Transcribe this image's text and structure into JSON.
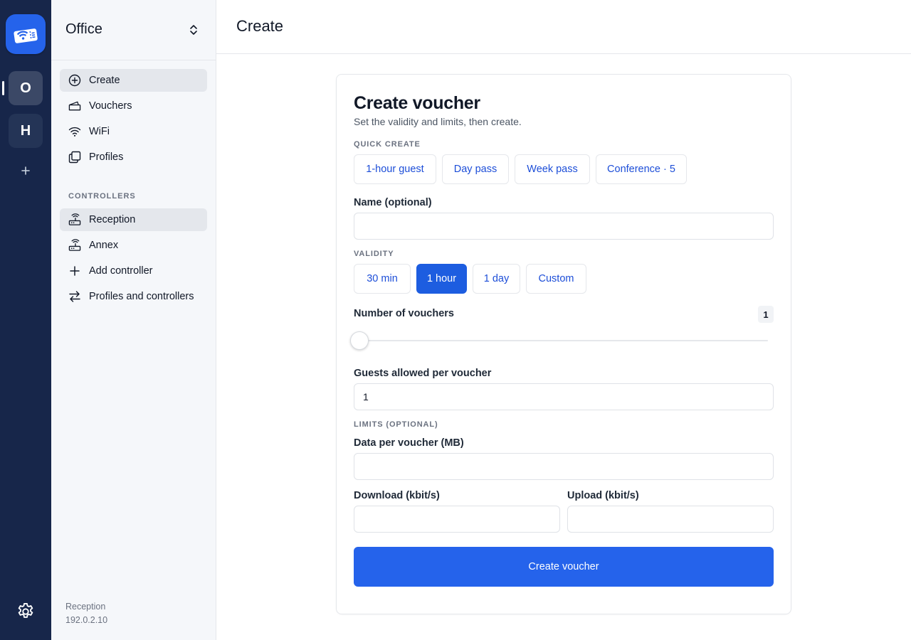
{
  "rail": {
    "profiles": [
      {
        "initial": "O",
        "active": true
      },
      {
        "initial": "H",
        "active": false
      }
    ],
    "icons": {
      "logo": "voucher-wifi-icon",
      "add": "plus-icon",
      "settings": "gear-icon"
    }
  },
  "sidebar": {
    "title": "Office",
    "items": [
      {
        "label": "Create",
        "icon": "plus-circle-icon",
        "active": true
      },
      {
        "label": "Vouchers",
        "icon": "ticket-icon",
        "active": false
      },
      {
        "label": "WiFi",
        "icon": "wifi-icon",
        "active": false
      },
      {
        "label": "Profiles",
        "icon": "stack-icon",
        "active": false
      }
    ],
    "controllers_label": "CONTROLLERS",
    "controllers": [
      {
        "label": "Reception",
        "icon": "router-icon",
        "active": true
      },
      {
        "label": "Annex",
        "icon": "router-icon",
        "active": false
      },
      {
        "label": "Add controller",
        "icon": "plus-icon",
        "active": false
      },
      {
        "label": "Profiles and controllers",
        "icon": "swap-icon",
        "active": false
      }
    ],
    "footer": {
      "name": "Reception",
      "ip": "192.0.2.10"
    }
  },
  "header": {
    "title": "Create"
  },
  "form": {
    "title": "Create voucher",
    "subtitle": "Set the validity and limits, then create.",
    "quick_create_label": "QUICK CREATE",
    "quick_create": [
      "1-hour guest",
      "Day pass",
      "Week pass",
      "Conference · 5"
    ],
    "name_label": "Name (optional)",
    "name_value": "",
    "validity_label": "VALIDITY",
    "validity_options": [
      "30 min",
      "1 hour",
      "1 day",
      "Custom"
    ],
    "validity_selected": "1 hour",
    "vouchers_label": "Number of vouchers",
    "vouchers_count": "1",
    "vouchers_slider_fraction": 0,
    "guests_label": "Guests allowed per voucher",
    "guests_value": "1",
    "limits_label": "LIMITS (OPTIONAL)",
    "data_label": "Data per voucher (MB)",
    "data_value": "",
    "download_label": "Download (kbit/s)",
    "download_value": "",
    "upload_label": "Upload (kbit/s)",
    "upload_value": "",
    "submit_label": "Create voucher"
  },
  "colors": {
    "rail": "#17264a",
    "accent": "#2563eb",
    "link": "#1d4ed8"
  }
}
